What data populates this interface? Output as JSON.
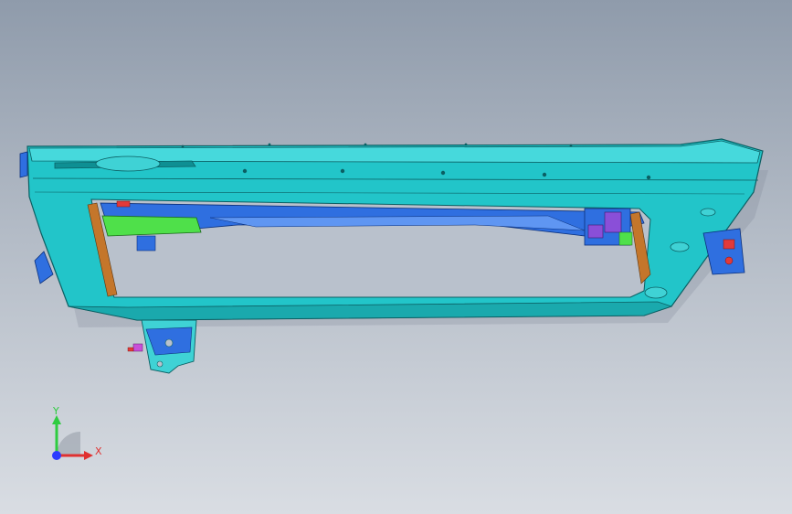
{
  "viewport": {
    "background_top": "#8f9bab",
    "background_bottom": "#d9dde3"
  },
  "model": {
    "frame_color": "#22c5c9",
    "frame_edge": "#0b5f63",
    "inner_panel_color": "#2f6fe0",
    "accent_green": "#4fe04a",
    "accent_orange": "#c4762b",
    "accent_purple": "#8a4fd8",
    "accent_red": "#e23a3a"
  },
  "triad": {
    "x_label": "X",
    "y_label": "Y",
    "x_color": "#e03030",
    "y_color": "#2ecc40",
    "origin_color": "#2b3cff"
  }
}
